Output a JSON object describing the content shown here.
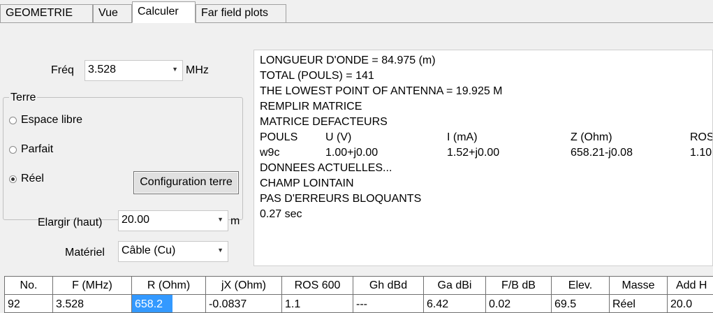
{
  "tabs": [
    "GEOMETRIE",
    "Vue",
    "Calculer",
    "Far field plots"
  ],
  "active_tab": "Calculer",
  "freq": {
    "label": "Fréq",
    "value": "3.528",
    "unit": "MHz"
  },
  "terre": {
    "title": "Terre",
    "options": [
      "Espace libre",
      "Parfait",
      "Réel"
    ],
    "selected": "Réel",
    "config_button": "Configuration terre"
  },
  "elargir": {
    "label": "Elargir (haut)",
    "value": "20.00",
    "unit": "m"
  },
  "materiel": {
    "label": "Matériel",
    "value": "Câble (Cu)"
  },
  "output": {
    "lines": [
      "LONGUEUR D'ONDE = 84.975 (m)",
      "TOTAL (POULS) = 141",
      "THE LOWEST POINT OF ANTENNA = 19.925 M",
      "REMPLIR MATRICE",
      "MATRICE DEFACTEURS"
    ],
    "table_header": [
      "POULS",
      "U (V)",
      "I (mA)",
      "Z (Ohm)",
      "ROS"
    ],
    "table_row": [
      "w9c",
      "1.00+j0.00",
      "1.52+j0.00",
      "658.21-j0.08",
      "1.10"
    ],
    "lines_after": [
      "DONNEES ACTUELLES...",
      "CHAMP LOINTAIN",
      "PAS D'ERREURS BLOQUANTS",
      "0.27 sec"
    ]
  },
  "grid": {
    "headers": [
      "No.",
      "F (MHz)",
      "R (Ohm)",
      "jX (Ohm)",
      "ROS  600",
      "Gh dBd",
      "Ga dBi",
      "F/B dB",
      "Elev.",
      "Masse",
      "Add H"
    ],
    "row": [
      "92",
      "3.528",
      "658.2",
      "-0.0837",
      "1.1",
      "---",
      "6.42",
      "0.02",
      "69.5",
      "Réel",
      "20.0"
    ],
    "selected_cell": "R (Ohm)",
    "selection_color": "#3399ff"
  }
}
